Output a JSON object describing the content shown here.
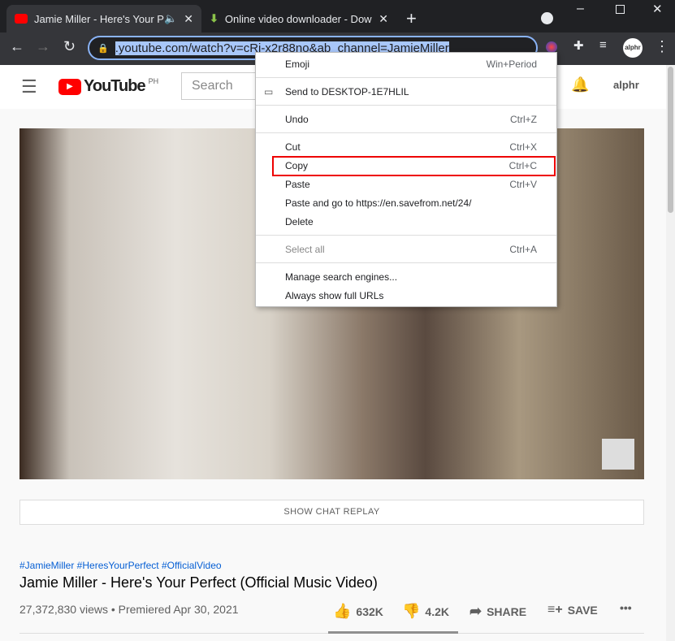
{
  "tabs": [
    {
      "title": "Jamie Miller - Here's Your Perfect",
      "icon": "youtube-icon"
    },
    {
      "title": "Online video downloader - Download",
      "icon": "download-arrow-icon"
    }
  ],
  "address": {
    "url": ".youtube.com/watch?v=cRi-x2r88no&ab_channel=JamieMiller"
  },
  "profile": "alphr",
  "youtube": {
    "logo": "YouTube",
    "region": "PH",
    "search_placeholder": "Search",
    "account": "alphr"
  },
  "chat_replay": "SHOW CHAT REPLAY",
  "video": {
    "hashtags": "#JamieMiller #HeresYourPerfect #OfficialVideo",
    "title": "Jamie Miller - Here's Your Perfect (Official Music Video)",
    "meta": "27,372,830 views • Premiered Apr 30, 2021",
    "likes": "632K",
    "dislikes": "4.2K",
    "share": "SHARE",
    "save": "SAVE"
  },
  "menu": [
    {
      "label": "Emoji",
      "shortcut": "Win+Period"
    },
    {
      "label": "Send to DESKTOP-1E7HLIL",
      "shortcut": ""
    },
    {
      "label": "Undo",
      "shortcut": "Ctrl+Z"
    },
    {
      "label": "Cut",
      "shortcut": "Ctrl+X"
    },
    {
      "label": "Copy",
      "shortcut": "Ctrl+C"
    },
    {
      "label": "Paste",
      "shortcut": "Ctrl+V"
    },
    {
      "label": "Paste and go to https://en.savefrom.net/24/",
      "shortcut": ""
    },
    {
      "label": "Delete",
      "shortcut": ""
    },
    {
      "label": "Select all",
      "shortcut": "Ctrl+A"
    },
    {
      "label": "Manage search engines...",
      "shortcut": ""
    },
    {
      "label": "Always show full URLs",
      "shortcut": ""
    }
  ]
}
